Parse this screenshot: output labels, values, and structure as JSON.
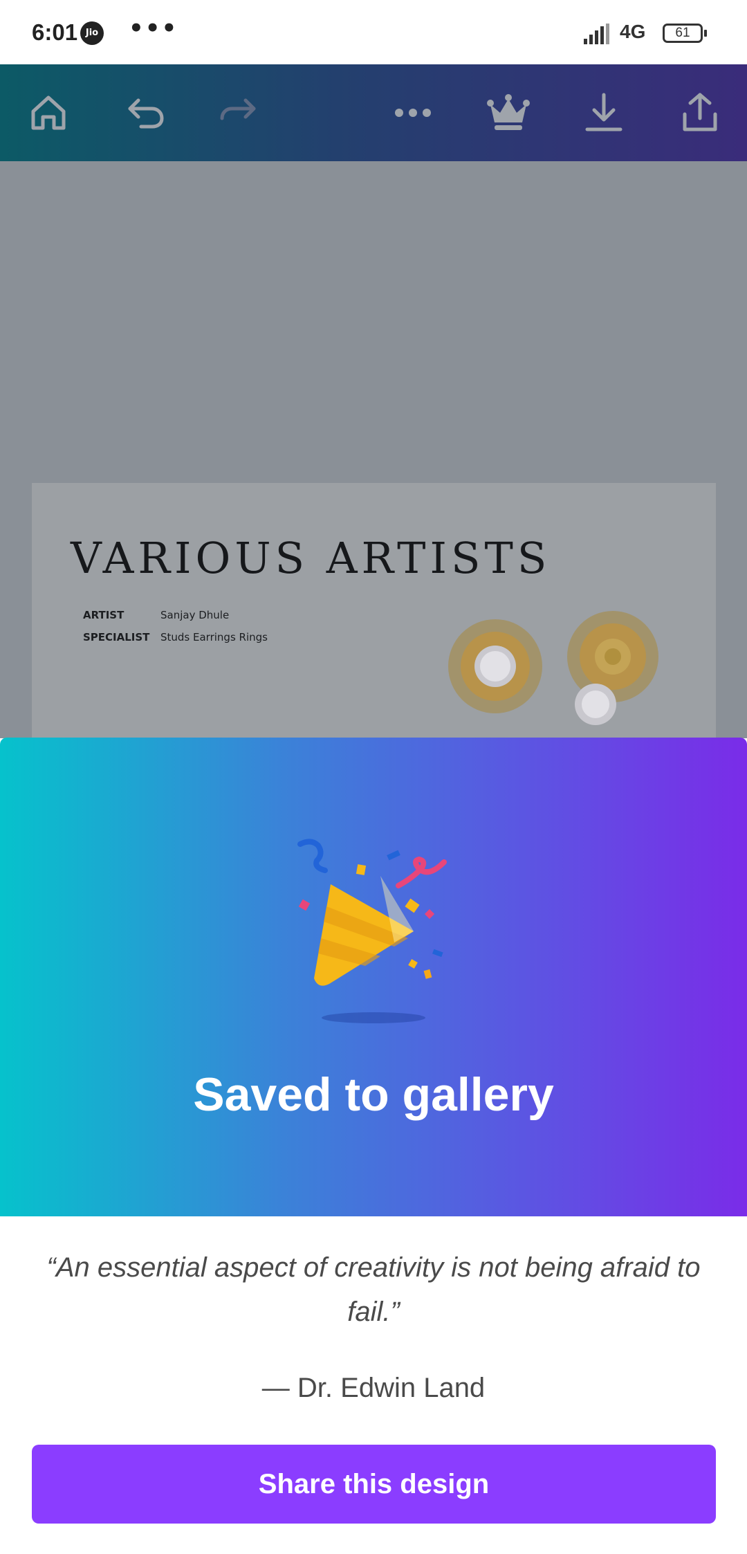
{
  "status_bar": {
    "time": "6:01",
    "carrier_badge": "Jio",
    "more": "•••",
    "network": "4G",
    "battery": "61"
  },
  "toolbar": {
    "icons": [
      "home-icon",
      "undo-icon",
      "redo-icon",
      "more-icon",
      "crown-icon",
      "download-icon",
      "share-icon"
    ]
  },
  "design": {
    "title": "VARIOUS ARTISTS",
    "rows": [
      {
        "label": "ARTIST",
        "value": "Sanjay Dhule"
      },
      {
        "label": "SPECIALIST",
        "value": "Studs Earrings Rings"
      }
    ]
  },
  "celebration": {
    "title": "Saved to gallery",
    "colors": {
      "start": "#06c2cc",
      "end": "#7a2ce8"
    }
  },
  "quote": {
    "text": "“An essential aspect of creativity is not being afraid to fail.”",
    "author": "— Dr. Edwin Land"
  },
  "share_button": {
    "label": "Share this design",
    "color": "#8b3dff"
  }
}
